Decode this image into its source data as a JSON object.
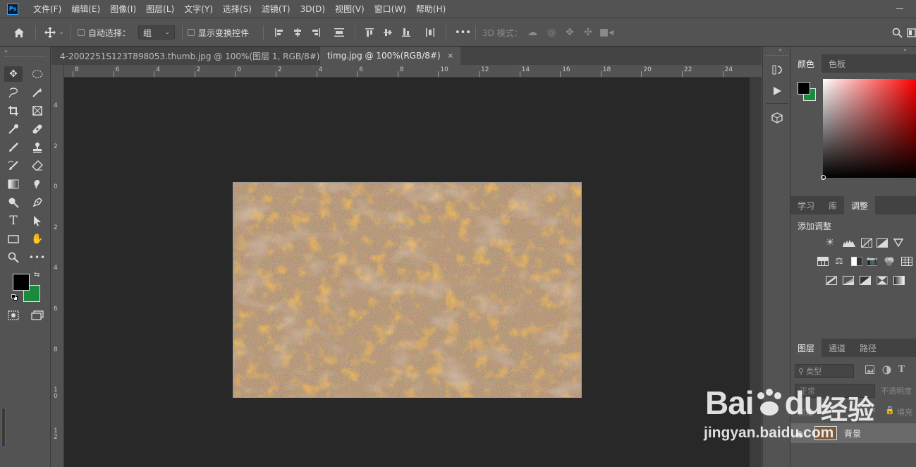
{
  "app": {
    "logo": "Ps"
  },
  "menu": [
    "文件(F)",
    "编辑(E)",
    "图像(I)",
    "图层(L)",
    "文字(Y)",
    "选择(S)",
    "滤镜(T)",
    "3D(D)",
    "视图(V)",
    "窗口(W)",
    "帮助(H)"
  ],
  "options": {
    "auto_select_label": "自动选择：",
    "auto_select_value": "组",
    "show_transform_label": "显示变换控件",
    "more": "•••",
    "mode_3d_label": "3D 模式："
  },
  "tabs": [
    {
      "label": "4-2002251S123T898053.thumb.jpg @ 100%(图层 1, RGB/8#) *",
      "close": "×"
    },
    {
      "label": "timg.jpg @ 100%(RGB/8#)",
      "close": "×"
    }
  ],
  "rulers": {
    "h": [
      "8",
      "6",
      "4",
      "2",
      "0",
      "2",
      "4",
      "6",
      "8",
      "10",
      "12",
      "14",
      "16",
      "18",
      "20",
      "22",
      "24"
    ],
    "v": [
      "4",
      "2",
      "0",
      "2",
      "4",
      "6",
      "8",
      "10",
      "12"
    ]
  },
  "color_panel": {
    "tabs": [
      "颜色",
      "色板"
    ],
    "fg": "#000000",
    "bg": "#1a8a3c"
  },
  "adjust_panel": {
    "tabs": [
      "学习",
      "库",
      "调整"
    ],
    "title": "添加调整"
  },
  "layers_panel": {
    "tabs": [
      "图层",
      "通道",
      "路径"
    ],
    "filter_label": "类型",
    "blend_mode": "正常",
    "opacity_label": "不透明度",
    "lock_label": "锁定",
    "fill_label": "填充",
    "layer_name": "背景"
  },
  "watermark": {
    "brand": "Bai",
    "brand2": "du",
    "cn": "经验",
    "url": "jingyan.baidu.com"
  },
  "colors": {
    "accent": "#31a8ff",
    "toolbar_bg": "#535353",
    "canvas_bg": "#282828"
  }
}
